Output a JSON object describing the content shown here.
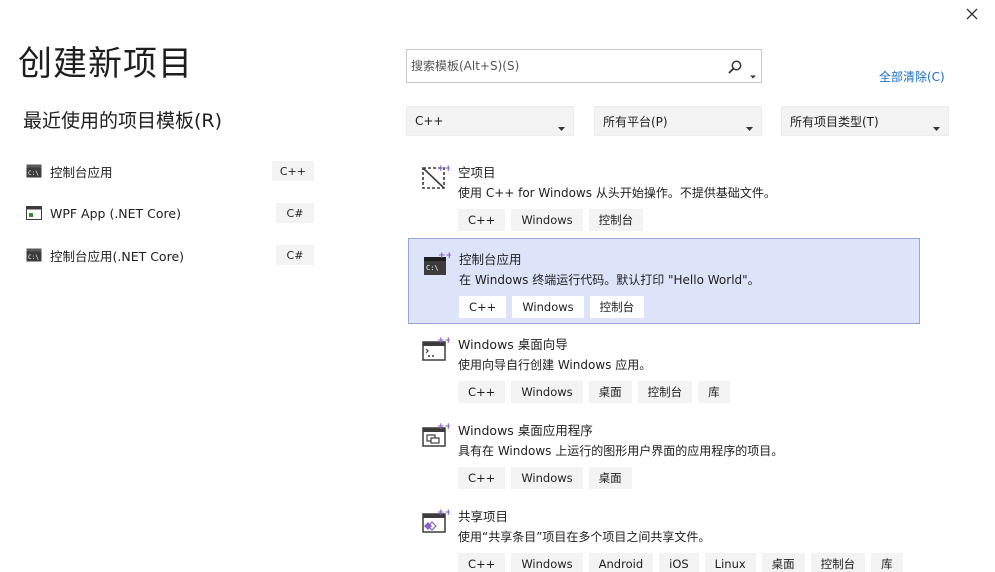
{
  "page_title": "创建新项目",
  "recent": {
    "title": "最近使用的项目模板(R)",
    "items": [
      {
        "label": "控制台应用",
        "lang": "C++",
        "icon": "console-icon"
      },
      {
        "label": "WPF App (.NET Core)",
        "lang": "C#",
        "icon": "wpf-window-icon"
      },
      {
        "label": "控制台应用(.NET Core)",
        "lang": "C#",
        "icon": "console-icon"
      }
    ]
  },
  "search": {
    "placeholder": "搜索模板(Alt+S)(S)",
    "value": ""
  },
  "clear_all_label": "全部清除(C)",
  "filters": {
    "language": "C++",
    "platform": "所有平台(P)",
    "project_type": "所有项目类型(T)"
  },
  "templates": [
    {
      "name": "空项目",
      "description": "使用 C++ for Windows 从头开始操作。不提供基础文件。",
      "tags": [
        "C++",
        "Windows",
        "控制台"
      ],
      "icon": "empty-project-icon",
      "selected": false
    },
    {
      "name": "控制台应用",
      "description": "在 Windows 终端运行代码。默认打印 \"Hello World\"。",
      "tags": [
        "C++",
        "Windows",
        "控制台"
      ],
      "icon": "console-app-icon",
      "selected": true
    },
    {
      "name": "Windows 桌面向导",
      "description": "使用向导自行创建 Windows 应用。",
      "tags": [
        "C++",
        "Windows",
        "桌面",
        "控制台",
        "库"
      ],
      "icon": "desktop-wizard-icon",
      "selected": false
    },
    {
      "name": "Windows 桌面应用程序",
      "description": "具有在 Windows 上运行的图形用户界面的应用程序的项目。",
      "tags": [
        "C++",
        "Windows",
        "桌面"
      ],
      "icon": "desktop-app-icon",
      "selected": false
    },
    {
      "name": "共享项目",
      "description": "使用“共享条目”项目在多个项目之间共享文件。",
      "tags": [
        "C++",
        "Windows",
        "Android",
        "iOS",
        "Linux",
        "桌面",
        "控制台",
        "库"
      ],
      "icon": "shared-project-icon",
      "selected": false
    }
  ],
  "colors": {
    "accent_link": "#1a6ec9",
    "selected_bg": "#dde3f8",
    "selected_border": "#9aa7d8",
    "tag_bg": "#f3f3f3",
    "cpp_icon": "#8661c5"
  }
}
